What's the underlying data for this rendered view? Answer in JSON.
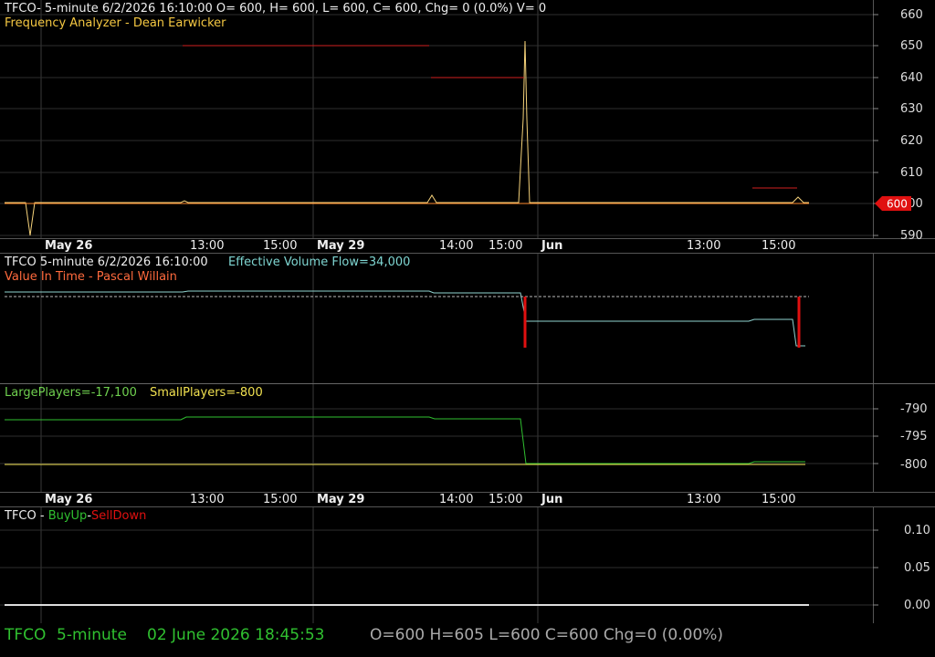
{
  "colors": {
    "bg": "#000000",
    "grid": "#333333",
    "yellow": "#f5d27a",
    "orange": "#ff8c30",
    "red": "#e01010",
    "cyan": "#8fd3d0",
    "green": "#30c030",
    "lightgreen": "#7fd06f",
    "white": "#dddddd"
  },
  "pane1": {
    "header": "TFCO- 5-minute 6/2/2026 16:10:00 O= 600, H= 600, L= 600, C= 600, Chg= 0 (0.0%) V= 0",
    "indicator": "Frequency Analyzer - Dean Earwicker",
    "y_ticks": [
      "660",
      "650",
      "640",
      "630",
      "620",
      "610",
      "600",
      "590"
    ],
    "last_price": "600"
  },
  "date_axis": {
    "labels": [
      "May 26",
      "13:00",
      "15:00",
      "May 29",
      "14:00",
      "15:00",
      "Jun",
      "13:00",
      "15:00"
    ]
  },
  "pane2": {
    "symbol": "TFCO 5-minute 6/2/2026 16:10:00",
    "flow": "Effective Volume Flow=34,000",
    "indicator": "Value In Time - Pascal Willain"
  },
  "pane3": {
    "large": "LargePlayers=-17,100",
    "small": "SmallPlayers=-800",
    "y_ticks": [
      "-790",
      "-795",
      "-800"
    ]
  },
  "pane4": {
    "prefix": "TFCO - ",
    "buy": "BuyUp",
    "dash": "-",
    "sell": "SellDown",
    "y_ticks": [
      "0.10",
      "0.05",
      "0.00"
    ]
  },
  "status": {
    "symbol": "TFCO",
    "interval": "5-minute",
    "datetime": "02 June 2026 18:45:53",
    "ohlc": "O=600  H=605  L=600  C=600  Chg=0 (0.00%)"
  }
}
